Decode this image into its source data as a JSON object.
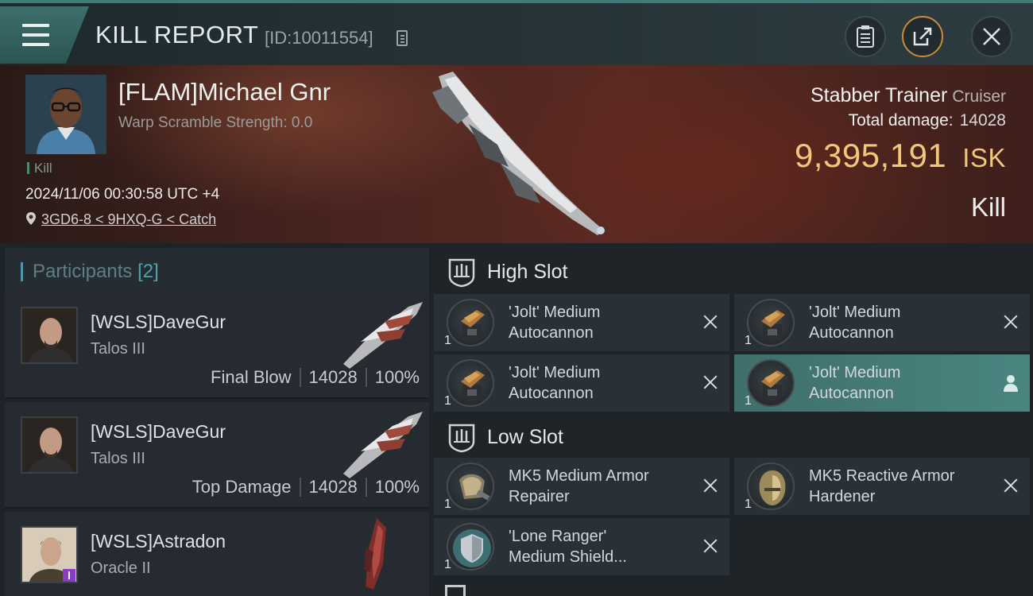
{
  "header": {
    "title": "KILL REPORT",
    "report_id": "[ID:10011554]"
  },
  "victim": {
    "name": "[FLAM]Michael Gnr",
    "warp_scramble": "Warp Scramble Strength: 0.0",
    "tag": "Kill",
    "timestamp": "2024/11/06 00:30:58 UTC +4",
    "location": "3GD6-8 < 9HXQ-G < Catch",
    "ship_name": "Stabber Trainer",
    "ship_class": "Cruiser",
    "total_damage_label": "Total damage:",
    "total_damage": "14028",
    "isk_value": "9,395,191",
    "isk_unit": "ISK",
    "result": "Kill"
  },
  "participants": {
    "label": "Participants",
    "count": "[2]",
    "list": [
      {
        "name": "[WSLS]DaveGur",
        "ship": "Talos III",
        "role": "Final Blow",
        "damage": "14028",
        "percent": "100%"
      },
      {
        "name": "[WSLS]DaveGur",
        "ship": "Talos III",
        "role": "Top Damage",
        "damage": "14028",
        "percent": "100%"
      },
      {
        "name": "[WSLS]Astradon",
        "ship": "Oracle II"
      }
    ]
  },
  "fitting": {
    "high_slot": {
      "title": "High Slot",
      "modules": [
        {
          "line1": "'Jolt' Medium",
          "line2": "Autocannon",
          "qty": "1",
          "status": "destroyed"
        },
        {
          "line1": "'Jolt' Medium",
          "line2": "Autocannon",
          "qty": "1",
          "status": "destroyed"
        },
        {
          "line1": "'Jolt' Medium",
          "line2": "Autocannon",
          "qty": "1",
          "status": "destroyed"
        },
        {
          "line1": "'Jolt' Medium",
          "line2": "Autocannon",
          "qty": "1",
          "status": "dropped"
        }
      ]
    },
    "low_slot": {
      "title": "Low Slot",
      "modules": [
        {
          "line1": "MK5 Medium Armor",
          "line2": "Repairer",
          "qty": "1",
          "status": "destroyed"
        },
        {
          "line1": "MK5 Reactive Armor",
          "line2": "Hardener",
          "qty": "1",
          "status": "destroyed"
        },
        {
          "line1": "'Lone Ranger'",
          "line2": "Medium Shield...",
          "qty": "1",
          "status": "destroyed"
        }
      ]
    }
  },
  "colors": {
    "accent_teal": "#4a8580",
    "isk_gold": "#f2c77a",
    "banner_red": "#5a2a22"
  },
  "icons": [
    "menu-icon",
    "copy-icon",
    "clipboard-icon",
    "share-icon",
    "close-icon",
    "location-pin-icon",
    "high-slot-icon",
    "low-slot-icon",
    "remove-x-icon",
    "user-icon"
  ]
}
